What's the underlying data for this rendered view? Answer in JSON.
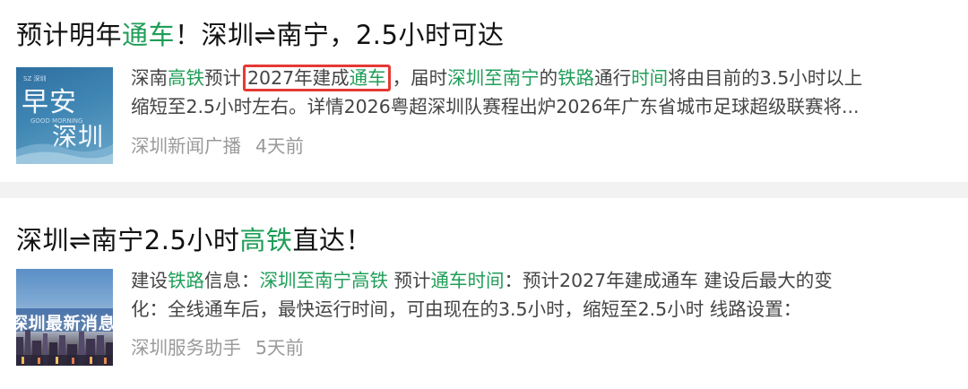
{
  "results": [
    {
      "title": [
        {
          "text": "预计明年",
          "hl": false
        },
        {
          "text": "通车",
          "hl": true
        },
        {
          "text": "！深圳⇌南宁，2.5小时可达",
          "hl": false
        }
      ],
      "thumbnail": {
        "line1": "早安",
        "line2": "深圳",
        "tiny_top": "SZ 深圳",
        "tiny_sub": "GOOD MORNING"
      },
      "snippet_line1": {
        "before": [
          {
            "text": "深南",
            "hl": false
          },
          {
            "text": "高铁",
            "hl": true
          },
          {
            "text": "预计",
            "hl": false
          }
        ],
        "boxed": [
          {
            "text": "2027年建成",
            "hl": false
          },
          {
            "text": "通车",
            "hl": true
          }
        ],
        "after": [
          {
            "text": "，届时",
            "hl": false
          },
          {
            "text": "深圳至南宁",
            "hl": true
          },
          {
            "text": "的",
            "hl": false
          },
          {
            "text": "铁路",
            "hl": true
          },
          {
            "text": "通行",
            "hl": false
          },
          {
            "text": "时间",
            "hl": true
          },
          {
            "text": "将由目前的3.5小时以上",
            "hl": false
          }
        ]
      },
      "snippet_line2": "缩短至2.5小时左右。详情2026粤超深圳队赛程出炉2026年广东省城市足球超级联赛将...",
      "source": "深圳新闻广播",
      "time": "4天前"
    },
    {
      "title": [
        {
          "text": "深圳⇌南宁2.5小时",
          "hl": false
        },
        {
          "text": "高铁",
          "hl": true
        },
        {
          "text": "直达！",
          "hl": false
        }
      ],
      "thumbnail": {
        "banner": "深圳最新消息"
      },
      "snippet_line1": [
        {
          "text": "建设",
          "hl": false
        },
        {
          "text": "铁路",
          "hl": true
        },
        {
          "text": "信息：",
          "hl": false
        },
        {
          "text": "深圳至南宁高铁",
          "hl": true
        },
        {
          "text": " 预计",
          "hl": false
        },
        {
          "text": "通车时间",
          "hl": true
        },
        {
          "text": "：预计2027年建成通车 建设后最大的变",
          "hl": false
        }
      ],
      "snippet_line2": "化：全线通车后，最快运行时间，可由现在的3.5小时，缩短至2.5小时 线路设置：",
      "source": "深圳服务助手",
      "time": "5天前"
    }
  ],
  "colors": {
    "highlight": "#1f9e58",
    "box": "#e53935",
    "meta": "#9a9a9a"
  }
}
